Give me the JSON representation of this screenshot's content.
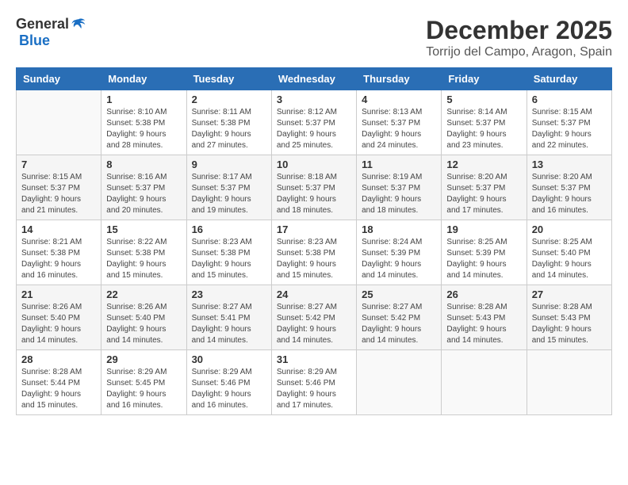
{
  "header": {
    "logo_general": "General",
    "logo_blue": "Blue",
    "month_title": "December 2025",
    "location": "Torrijo del Campo, Aragon, Spain"
  },
  "weekdays": [
    "Sunday",
    "Monday",
    "Tuesday",
    "Wednesday",
    "Thursday",
    "Friday",
    "Saturday"
  ],
  "weeks": [
    [
      {
        "day": "",
        "sunrise": "",
        "sunset": "",
        "daylight": ""
      },
      {
        "day": "1",
        "sunrise": "Sunrise: 8:10 AM",
        "sunset": "Sunset: 5:38 PM",
        "daylight": "Daylight: 9 hours and 28 minutes."
      },
      {
        "day": "2",
        "sunrise": "Sunrise: 8:11 AM",
        "sunset": "Sunset: 5:38 PM",
        "daylight": "Daylight: 9 hours and 27 minutes."
      },
      {
        "day": "3",
        "sunrise": "Sunrise: 8:12 AM",
        "sunset": "Sunset: 5:37 PM",
        "daylight": "Daylight: 9 hours and 25 minutes."
      },
      {
        "day": "4",
        "sunrise": "Sunrise: 8:13 AM",
        "sunset": "Sunset: 5:37 PM",
        "daylight": "Daylight: 9 hours and 24 minutes."
      },
      {
        "day": "5",
        "sunrise": "Sunrise: 8:14 AM",
        "sunset": "Sunset: 5:37 PM",
        "daylight": "Daylight: 9 hours and 23 minutes."
      },
      {
        "day": "6",
        "sunrise": "Sunrise: 8:15 AM",
        "sunset": "Sunset: 5:37 PM",
        "daylight": "Daylight: 9 hours and 22 minutes."
      }
    ],
    [
      {
        "day": "7",
        "sunrise": "Sunrise: 8:15 AM",
        "sunset": "Sunset: 5:37 PM",
        "daylight": "Daylight: 9 hours and 21 minutes."
      },
      {
        "day": "8",
        "sunrise": "Sunrise: 8:16 AM",
        "sunset": "Sunset: 5:37 PM",
        "daylight": "Daylight: 9 hours and 20 minutes."
      },
      {
        "day": "9",
        "sunrise": "Sunrise: 8:17 AM",
        "sunset": "Sunset: 5:37 PM",
        "daylight": "Daylight: 9 hours and 19 minutes."
      },
      {
        "day": "10",
        "sunrise": "Sunrise: 8:18 AM",
        "sunset": "Sunset: 5:37 PM",
        "daylight": "Daylight: 9 hours and 18 minutes."
      },
      {
        "day": "11",
        "sunrise": "Sunrise: 8:19 AM",
        "sunset": "Sunset: 5:37 PM",
        "daylight": "Daylight: 9 hours and 18 minutes."
      },
      {
        "day": "12",
        "sunrise": "Sunrise: 8:20 AM",
        "sunset": "Sunset: 5:37 PM",
        "daylight": "Daylight: 9 hours and 17 minutes."
      },
      {
        "day": "13",
        "sunrise": "Sunrise: 8:20 AM",
        "sunset": "Sunset: 5:37 PM",
        "daylight": "Daylight: 9 hours and 16 minutes."
      }
    ],
    [
      {
        "day": "14",
        "sunrise": "Sunrise: 8:21 AM",
        "sunset": "Sunset: 5:38 PM",
        "daylight": "Daylight: 9 hours and 16 minutes."
      },
      {
        "day": "15",
        "sunrise": "Sunrise: 8:22 AM",
        "sunset": "Sunset: 5:38 PM",
        "daylight": "Daylight: 9 hours and 15 minutes."
      },
      {
        "day": "16",
        "sunrise": "Sunrise: 8:23 AM",
        "sunset": "Sunset: 5:38 PM",
        "daylight": "Daylight: 9 hours and 15 minutes."
      },
      {
        "day": "17",
        "sunrise": "Sunrise: 8:23 AM",
        "sunset": "Sunset: 5:38 PM",
        "daylight": "Daylight: 9 hours and 15 minutes."
      },
      {
        "day": "18",
        "sunrise": "Sunrise: 8:24 AM",
        "sunset": "Sunset: 5:39 PM",
        "daylight": "Daylight: 9 hours and 14 minutes."
      },
      {
        "day": "19",
        "sunrise": "Sunrise: 8:25 AM",
        "sunset": "Sunset: 5:39 PM",
        "daylight": "Daylight: 9 hours and 14 minutes."
      },
      {
        "day": "20",
        "sunrise": "Sunrise: 8:25 AM",
        "sunset": "Sunset: 5:40 PM",
        "daylight": "Daylight: 9 hours and 14 minutes."
      }
    ],
    [
      {
        "day": "21",
        "sunrise": "Sunrise: 8:26 AM",
        "sunset": "Sunset: 5:40 PM",
        "daylight": "Daylight: 9 hours and 14 minutes."
      },
      {
        "day": "22",
        "sunrise": "Sunrise: 8:26 AM",
        "sunset": "Sunset: 5:40 PM",
        "daylight": "Daylight: 9 hours and 14 minutes."
      },
      {
        "day": "23",
        "sunrise": "Sunrise: 8:27 AM",
        "sunset": "Sunset: 5:41 PM",
        "daylight": "Daylight: 9 hours and 14 minutes."
      },
      {
        "day": "24",
        "sunrise": "Sunrise: 8:27 AM",
        "sunset": "Sunset: 5:42 PM",
        "daylight": "Daylight: 9 hours and 14 minutes."
      },
      {
        "day": "25",
        "sunrise": "Sunrise: 8:27 AM",
        "sunset": "Sunset: 5:42 PM",
        "daylight": "Daylight: 9 hours and 14 minutes."
      },
      {
        "day": "26",
        "sunrise": "Sunrise: 8:28 AM",
        "sunset": "Sunset: 5:43 PM",
        "daylight": "Daylight: 9 hours and 14 minutes."
      },
      {
        "day": "27",
        "sunrise": "Sunrise: 8:28 AM",
        "sunset": "Sunset: 5:43 PM",
        "daylight": "Daylight: 9 hours and 15 minutes."
      }
    ],
    [
      {
        "day": "28",
        "sunrise": "Sunrise: 8:28 AM",
        "sunset": "Sunset: 5:44 PM",
        "daylight": "Daylight: 9 hours and 15 minutes."
      },
      {
        "day": "29",
        "sunrise": "Sunrise: 8:29 AM",
        "sunset": "Sunset: 5:45 PM",
        "daylight": "Daylight: 9 hours and 16 minutes."
      },
      {
        "day": "30",
        "sunrise": "Sunrise: 8:29 AM",
        "sunset": "Sunset: 5:46 PM",
        "daylight": "Daylight: 9 hours and 16 minutes."
      },
      {
        "day": "31",
        "sunrise": "Sunrise: 8:29 AM",
        "sunset": "Sunset: 5:46 PM",
        "daylight": "Daylight: 9 hours and 17 minutes."
      },
      {
        "day": "",
        "sunrise": "",
        "sunset": "",
        "daylight": ""
      },
      {
        "day": "",
        "sunrise": "",
        "sunset": "",
        "daylight": ""
      },
      {
        "day": "",
        "sunrise": "",
        "sunset": "",
        "daylight": ""
      }
    ]
  ]
}
